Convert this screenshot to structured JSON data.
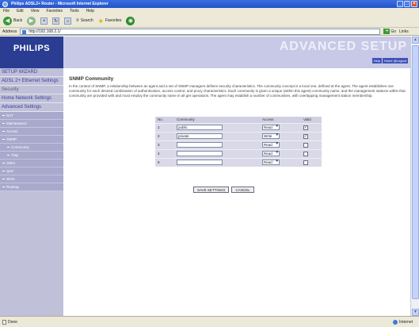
{
  "window": {
    "title": "Philips ADSL2+ Router - Microsoft Internet Explorer"
  },
  "menu": [
    "File",
    "Edit",
    "View",
    "Favorites",
    "Tools",
    "Help"
  ],
  "toolbar": {
    "back_label": "Back",
    "search_label": "Search",
    "favorites_label": "Favorites"
  },
  "address": {
    "label": "Address",
    "url": "http://192.168.2.1/",
    "go_label": "Go",
    "links_label": "Links"
  },
  "header": {
    "logo": "PHILIPS",
    "banner": "ADVANCED SETUP",
    "help_link": "Help",
    "logout_link": "Home @Logout"
  },
  "sidebar": {
    "setup_wizard": "SETUP WIZARD",
    "adsl_settings": "ADSL 2+ Ethernet Settings",
    "security": "Security",
    "home_network": "Home Network Settings",
    "advanced_settings": "Advanced Settings",
    "items": [
      {
        "label": "NAT",
        "level": 1
      },
      {
        "label": "Maintenance",
        "level": 1
      },
      {
        "label": "Access",
        "level": 1
      },
      {
        "label": "SNMP",
        "level": 1
      },
      {
        "label": "Community",
        "level": 2
      },
      {
        "label": "Trap",
        "level": 2
      },
      {
        "label": "Other",
        "level": 1
      },
      {
        "label": "QoS",
        "level": 1
      },
      {
        "label": "WAN",
        "level": 1
      },
      {
        "label": "Routing",
        "level": 1
      }
    ]
  },
  "page": {
    "title": "SNMP Community",
    "description": "In the context of SNMP, a relationship between an agent and a set of SNMP managers defines security characteristics. The community concept is a local one, defined at the agent. The agent establishes one community for each desired combination of authentication, access control, and proxy characteristics. Each community is given a unique (within this agent) community name, and the management stations within that community are provided with and must employ the community name in all get operations. The agent may establish a number of communities, with overlapping management station membership.",
    "table": {
      "headers": [
        "No.",
        "Community",
        "Access",
        "Valid"
      ],
      "rows": [
        {
          "no": "1",
          "community": "public",
          "access": "Read",
          "valid": true
        },
        {
          "no": "2",
          "community": "private",
          "access": "Write",
          "valid": true
        },
        {
          "no": "3",
          "community": "",
          "access": "Read",
          "valid": false
        },
        {
          "no": "4",
          "community": "",
          "access": "Read",
          "valid": false
        },
        {
          "no": "5",
          "community": "",
          "access": "Read",
          "valid": false
        }
      ]
    },
    "save_label": "SAVE SETTINGS",
    "cancel_label": "CANCEL"
  },
  "status": {
    "left": "Done",
    "zone": "Internet"
  }
}
